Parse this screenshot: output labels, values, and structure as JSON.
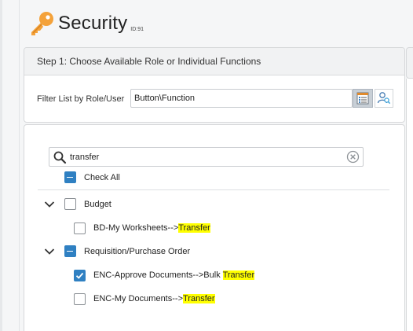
{
  "header": {
    "title": "Security",
    "id_label": "ID:91"
  },
  "step1": {
    "heading": "Step 1: Choose Available Role or Individual Functions",
    "filter_label": "Filter List by Role/User",
    "filter_value": "Button\\Function"
  },
  "search": {
    "value": "transfer"
  },
  "check_all_label": "Check All",
  "tree": {
    "groups": [
      {
        "label": "Budget",
        "state": "unchecked",
        "items": [
          {
            "prefix": "BD-My Worksheets-->",
            "match": "Transfer",
            "state": "unchecked"
          }
        ]
      },
      {
        "label": "Requisition/Purchase Order",
        "state": "indeterminate",
        "items": [
          {
            "prefix": "ENC-Approve Documents-->Bulk ",
            "match": "Transfer",
            "state": "checked"
          },
          {
            "prefix": "ENC-My Documents-->",
            "match": "Transfer",
            "state": "unchecked"
          }
        ]
      }
    ]
  },
  "colors": {
    "accent": "#2f80c2",
    "highlight": "#ffff00",
    "key_icon": "#f4a23a"
  }
}
